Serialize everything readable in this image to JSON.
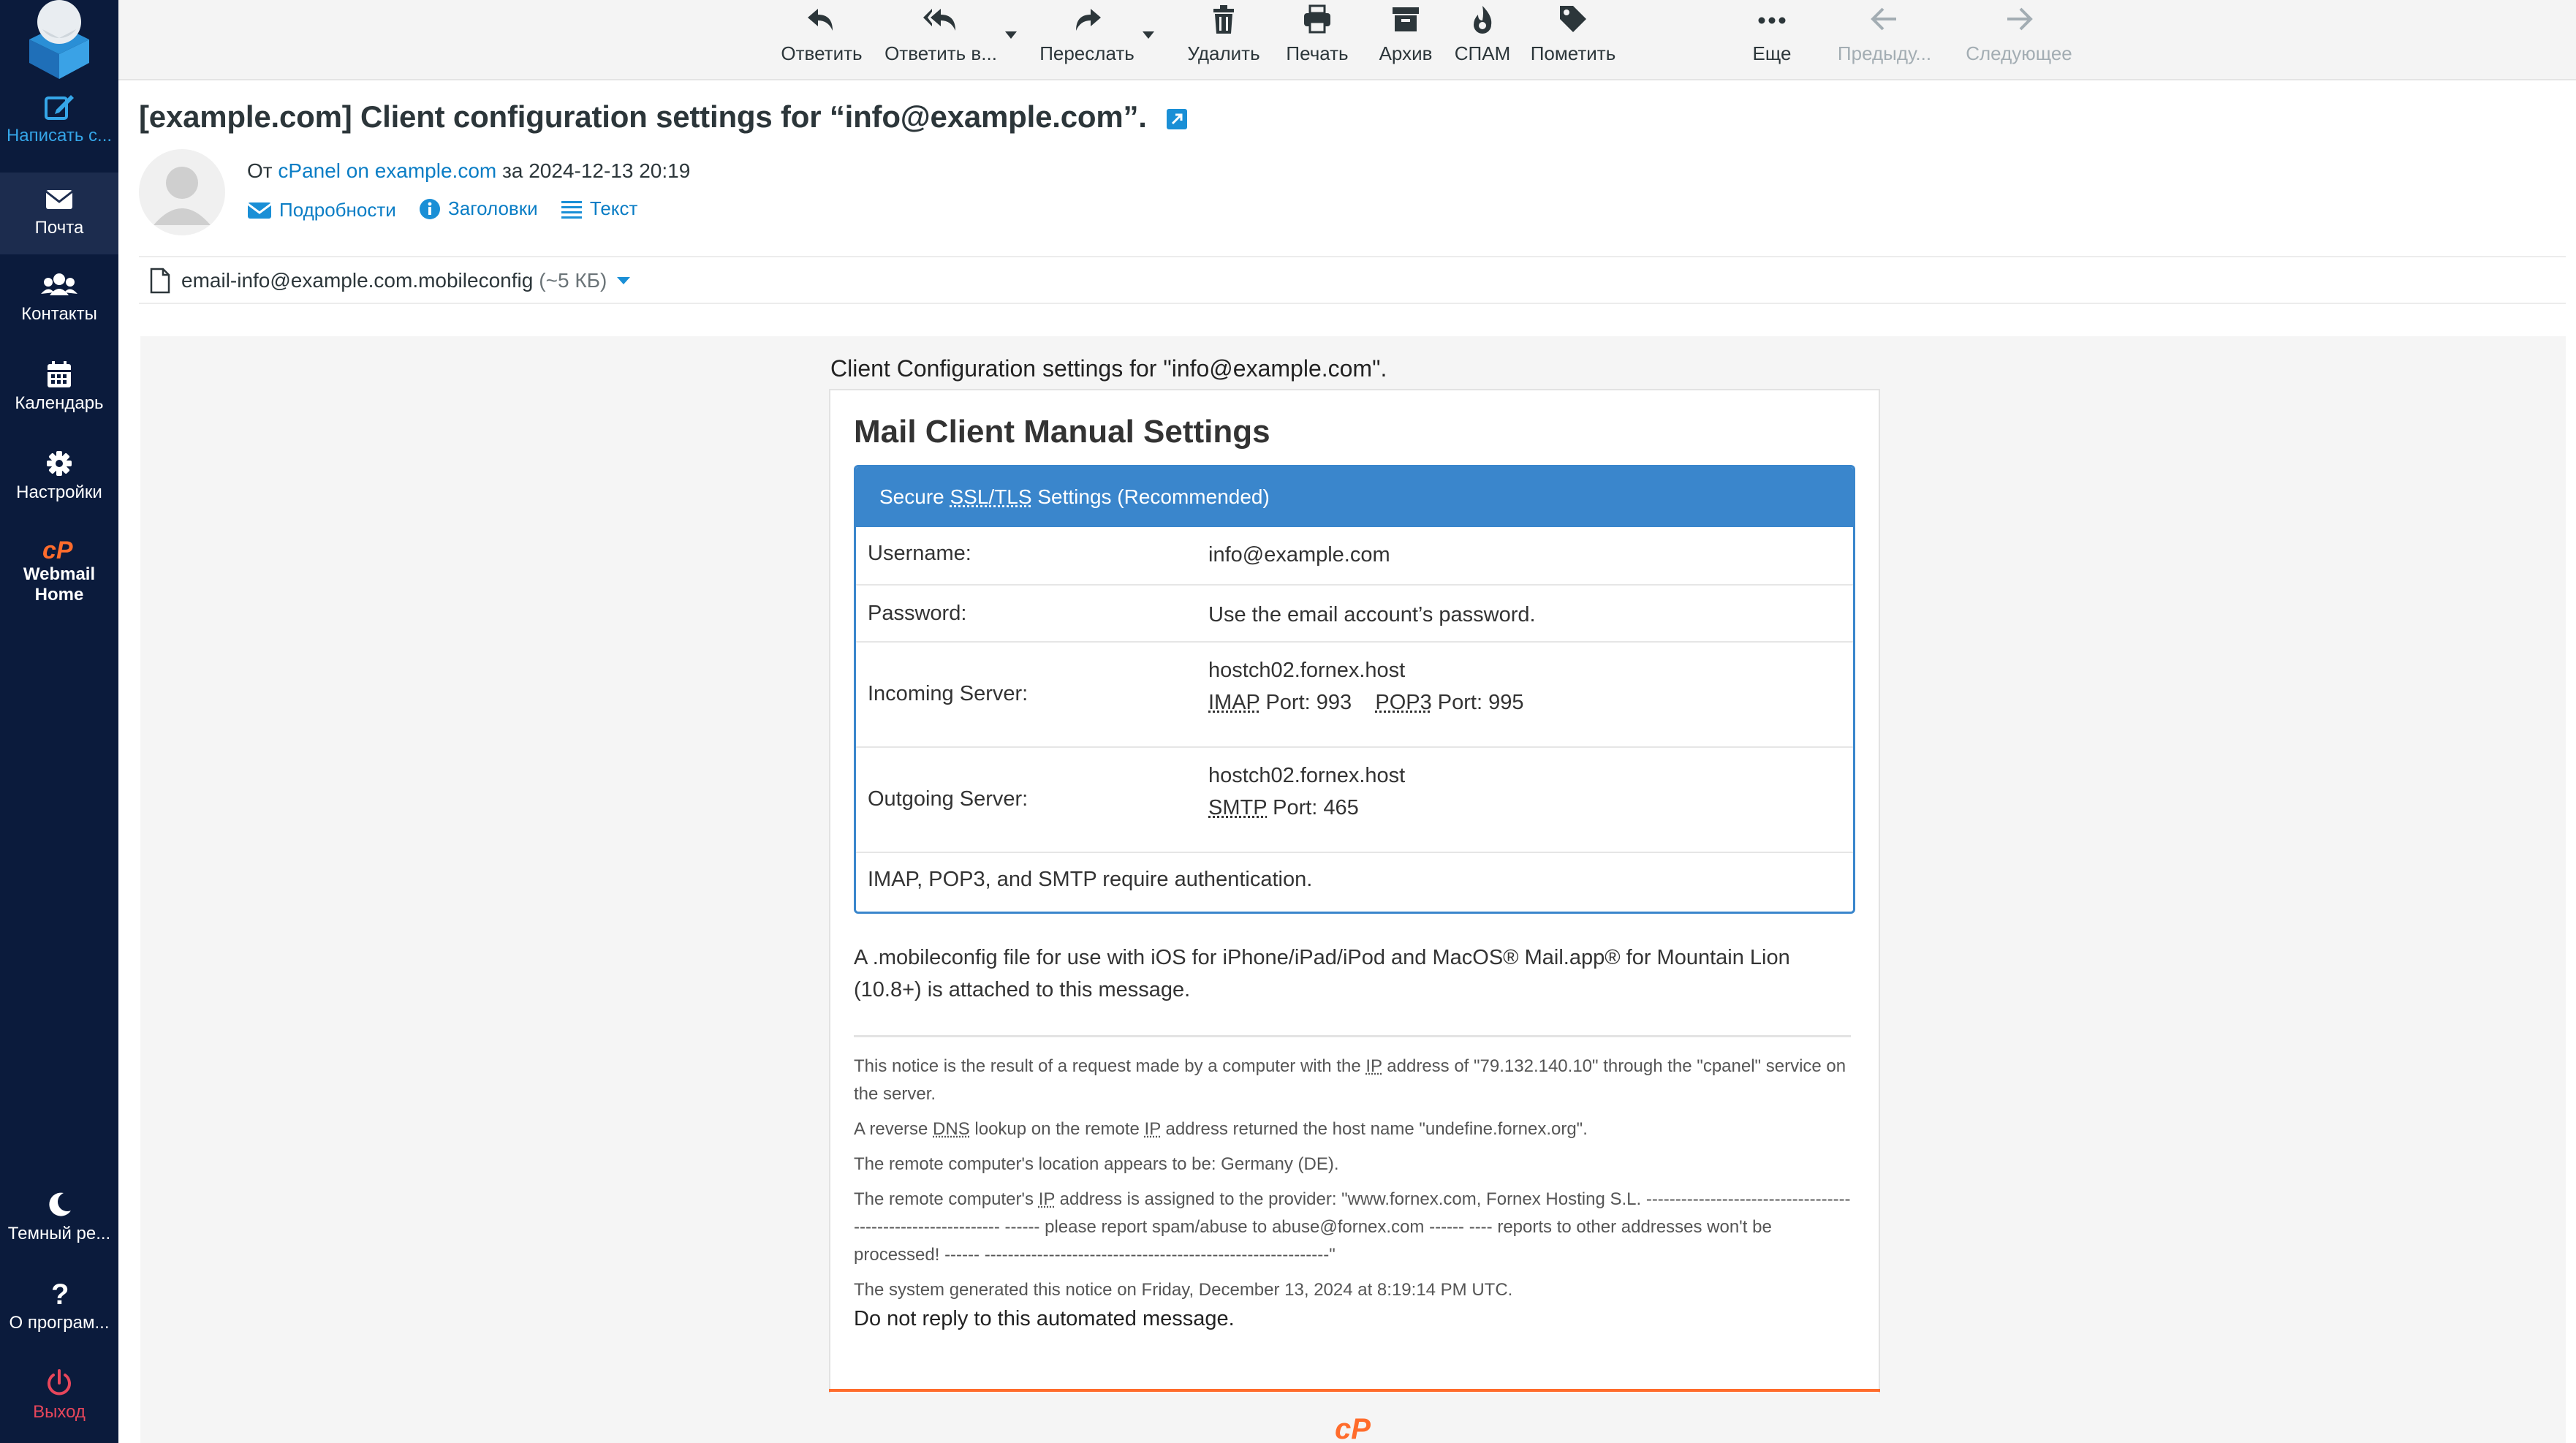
{
  "sidebar": {
    "compose": "Написать с...",
    "mail": "Почта",
    "contacts": "Контакты",
    "calendar": "Календарь",
    "settings": "Настройки",
    "webmail_home_1": "Webmail",
    "webmail_home_2": "Home",
    "dark_mode": "Темный ре...",
    "about": "О програм...",
    "logout": "Выход"
  },
  "toolbar": {
    "reply": "Ответить",
    "reply_all": "Ответить в...",
    "forward": "Переслать",
    "delete": "Удалить",
    "print": "Печать",
    "archive": "Архив",
    "spam": "СПАМ",
    "mark": "Пометить",
    "more": "Еще",
    "prev": "Предыду...",
    "next": "Следующее"
  },
  "message": {
    "subject": "[example.com] Client configuration settings for “info@example.com”.",
    "from_prefix": "От",
    "from_name": "cPanel on example.com",
    "date_prefix": "за",
    "date": "2024-12-13 20:19",
    "links": {
      "details": "Подробности",
      "headers": "Заголовки",
      "text": "Текст"
    },
    "attachment": {
      "name": "email-info@example.com.mobileconfig",
      "size": "(~5 КБ)"
    }
  },
  "body": {
    "intro": "Client Configuration settings for \"info@example.com\".",
    "title": "Mail Client Manual Settings",
    "settings_head_pre": "Secure ",
    "settings_head_abbr": "SSL/TLS",
    "settings_head_post": " Settings (Recommended)",
    "rows": {
      "username_label": "Username:",
      "username_value": "info@example.com",
      "password_label": "Password:",
      "password_value": "Use the email account’s password.",
      "incoming_label": "Incoming Server:",
      "incoming_host": "hostch02.fornex.host",
      "imap": "IMAP",
      "imap_port": " Port: 993",
      "pop3": "POP3",
      "pop3_port": " Port: 995",
      "outgoing_label": "Outgoing Server:",
      "outgoing_host": "hostch02.fornex.host",
      "smtp": "SMTP",
      "smtp_port": " Port: 465",
      "auth_note": "IMAP, POP3, and SMTP require authentication."
    },
    "mobile_note": "A .mobileconfig file for use with iOS for iPhone/iPad/iPod and MacOS® Mail.app® for Mountain Lion (10.8+) is attached to this message.",
    "notice": {
      "p1_a": "This notice is the result of a request made by a computer with the ",
      "p1_ip": "IP",
      "p1_b": " address of \"79.132.140.10\" through the \"cpanel\" service on the server.",
      "p2_a": "A reverse ",
      "p2_dns": "DNS",
      "p2_b": " lookup on the remote ",
      "p2_ip": "IP",
      "p2_c": " address returned the host name \"undefine.fornex.org\".",
      "p3": "The remote computer's location appears to be: Germany (DE).",
      "p4_a": "The remote computer's ",
      "p4_ip": "IP",
      "p4_b": " address is assigned to the provider: \"www.fornex.com, Fornex Hosting S.L. ------------------------------------------------------------ ------ please report spam/abuse to abuse@fornex.com ------ ---- reports to other addresses won't be processed! ------ -----------------------------------------------------------\"",
      "p5": "The system generated this notice on Friday, December 13, 2024 at 8:19:14 PM UTC."
    },
    "noreply": "Do not reply to this automated message."
  },
  "colors": {
    "sidebar_bg": "#0b1b3c",
    "accent_blue": "#3a86cc",
    "link_blue": "#0a7dc5",
    "cpanel_orange": "#ff6c2c",
    "logout_red": "#e7465b"
  }
}
